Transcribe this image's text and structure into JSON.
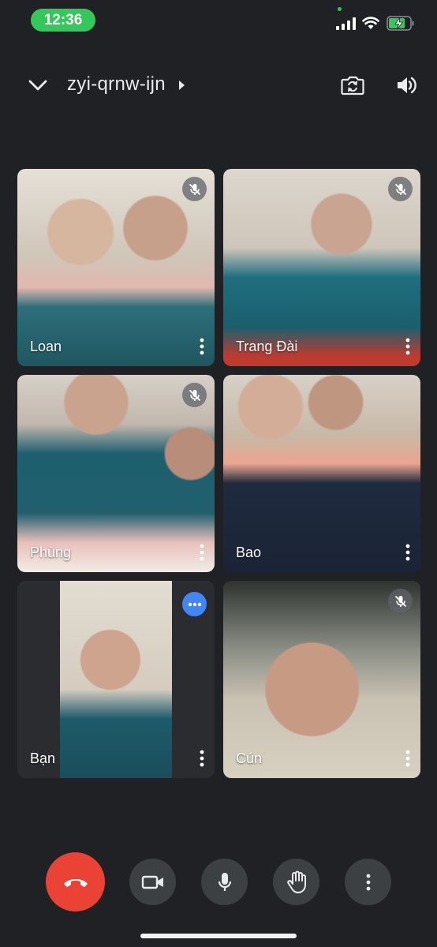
{
  "status_bar": {
    "time": "12:36"
  },
  "header": {
    "meeting_code": "zyi-qrnw-ijn"
  },
  "participants": [
    {
      "name": "Loan",
      "muted": true
    },
    {
      "name": "Trang Đài",
      "muted": true
    },
    {
      "name": "Phùng",
      "muted": true
    },
    {
      "name": "Bao",
      "muted": false
    },
    {
      "name": "Bạn",
      "muted": false,
      "speaking": true
    },
    {
      "name": "Cún",
      "muted": true
    }
  ],
  "controls": [
    "end-call",
    "camera",
    "microphone",
    "raise-hand",
    "more-options"
  ],
  "colors": {
    "accent_green": "#34c759",
    "end_call_red": "#ea4335",
    "speaking_blue": "#4285f4",
    "background": "#202124",
    "control_grey": "#3c4043"
  }
}
